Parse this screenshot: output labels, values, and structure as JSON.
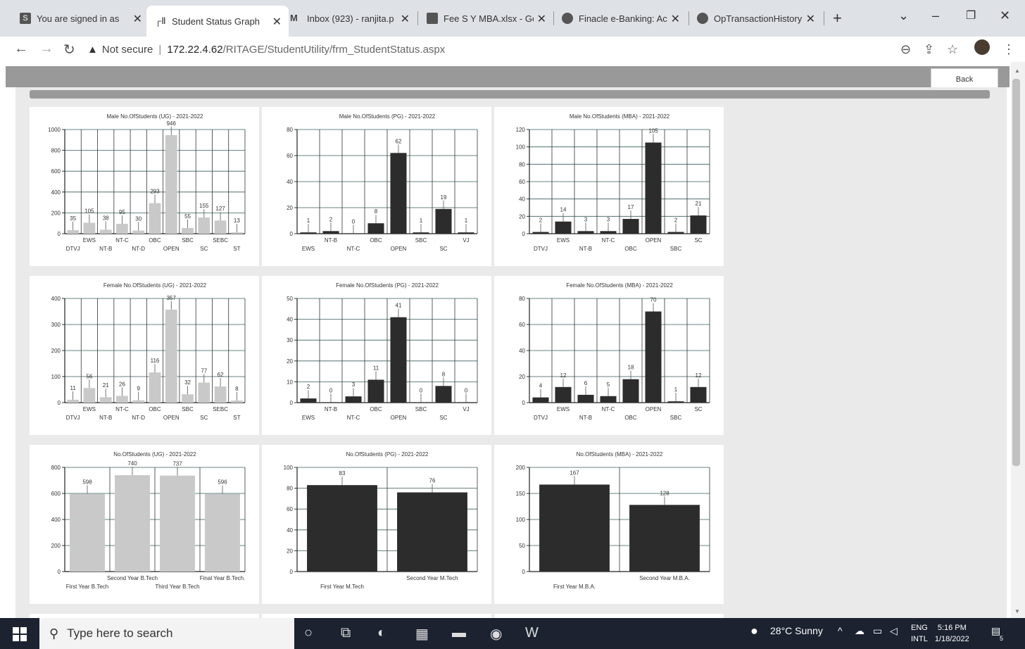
{
  "browser": {
    "tabs": [
      {
        "title": "You are signed in as E",
        "icon": "site-icon"
      },
      {
        "title": "Student Status Graph",
        "icon": "chart-icon"
      },
      {
        "title": "Inbox (923) - ranjita.p",
        "icon": "gmail-icon"
      },
      {
        "title": "Fee S Y MBA.xlsx - Go",
        "icon": "sheets-icon"
      },
      {
        "title": "Finacle e-Banking: Ac",
        "icon": "globe-icon"
      },
      {
        "title": "OpTransactionHistory",
        "icon": "globe-icon"
      }
    ],
    "address": {
      "security": "Not secure",
      "host": "172.22.4.62",
      "path": "/RITAGE/StudentUtility/frm_StudentStatus.aspx"
    }
  },
  "page": {
    "back_label": "Back"
  },
  "taskbar": {
    "search_placeholder": "Type here to search",
    "weather": "28°C  Sunny",
    "lang1": "ENG",
    "lang2": "INTL",
    "time": "5:16 PM",
    "date": "1/18/2022",
    "notif_count": "5"
  },
  "colors": {
    "light_bar": "#c9c9c9",
    "dark_bar": "#2c2c2c",
    "gridline": "#3a5a5a"
  },
  "chart_data": [
    {
      "type": "bar",
      "title": "Male  No.OfStudents (UG) - 2021-2022",
      "categories": [
        "DTVJ",
        "EWS",
        "NT-B",
        "NT-C",
        "NT-D",
        "OBC",
        "OPEN",
        "SBC",
        "SC",
        "SEBC",
        "ST"
      ],
      "values": [
        35,
        105,
        38,
        95,
        30,
        293,
        946,
        55,
        155,
        127,
        13
      ],
      "ylim": [
        0,
        1000
      ],
      "yticks": [
        0,
        200,
        400,
        600,
        800,
        1000
      ],
      "bar": "light"
    },
    {
      "type": "bar",
      "title": "Male  No.OfStudents (PG) - 2021-2022",
      "categories": [
        "EWS",
        "NT-B",
        "NT-C",
        "OBC",
        "OPEN",
        "SBC",
        "SC",
        "VJ"
      ],
      "values": [
        1,
        2,
        0,
        8,
        62,
        1,
        19,
        1
      ],
      "ylim": [
        0,
        80
      ],
      "yticks": [
        0,
        20,
        40,
        60,
        80
      ],
      "bar": "dark"
    },
    {
      "type": "bar",
      "title": "Male  No.OfStudents (MBA) - 2021-2022",
      "categories": [
        "DTVJ",
        "EWS",
        "NT-B",
        "NT-C",
        "OBC",
        "OPEN",
        "SBC",
        "SC"
      ],
      "values": [
        2,
        14,
        3,
        3,
        17,
        105,
        2,
        21
      ],
      "ylim": [
        0,
        120
      ],
      "yticks": [
        0,
        20,
        40,
        60,
        80,
        100,
        120
      ],
      "bar": "dark"
    },
    {
      "type": "bar",
      "title": "Female  No.OfStudents (UG) - 2021-2022",
      "categories": [
        "DTVJ",
        "EWS",
        "NT-B",
        "NT-C",
        "NT-D",
        "OBC",
        "OPEN",
        "SBC",
        "SC",
        "SEBC",
        "ST"
      ],
      "values": [
        11,
        56,
        21,
        26,
        9,
        116,
        357,
        32,
        77,
        62,
        8
      ],
      "ylim": [
        0,
        400
      ],
      "yticks": [
        0,
        100,
        200,
        300,
        400
      ],
      "bar": "light"
    },
    {
      "type": "bar",
      "title": "Female  No.OfStudents (PG) - 2021-2022",
      "categories": [
        "EWS",
        "NT-B",
        "NT-C",
        "OBC",
        "OPEN",
        "SBC",
        "SC",
        "VJ"
      ],
      "values": [
        2,
        0,
        3,
        11,
        41,
        0,
        8,
        0
      ],
      "ylim": [
        0,
        50
      ],
      "yticks": [
        0,
        10,
        20,
        30,
        40,
        50
      ],
      "bar": "dark"
    },
    {
      "type": "bar",
      "title": "Female  No.OfStudents (MBA) - 2021-2022",
      "categories": [
        "DTVJ",
        "EWS",
        "NT-B",
        "NT-C",
        "OBC",
        "OPEN",
        "SBC",
        "SC"
      ],
      "values": [
        4,
        12,
        6,
        5,
        18,
        70,
        1,
        12
      ],
      "ylim": [
        0,
        80
      ],
      "yticks": [
        0,
        20,
        40,
        60,
        80
      ],
      "bar": "dark"
    },
    {
      "type": "bar",
      "title": "No.OfStudents (UG) - 2021-2022",
      "categories": [
        "First Year B.Tech",
        "Second Year B.Tech",
        "Third Year B.Tech",
        "Final Year B.Tech."
      ],
      "values": [
        598,
        740,
        737,
        596
      ],
      "ylim": [
        0,
        800
      ],
      "yticks": [
        0,
        200,
        400,
        600,
        800
      ],
      "bar": "light"
    },
    {
      "type": "bar",
      "title": "No.OfStudents (PG) - 2021-2022",
      "categories": [
        "First Year M.Tech",
        "Second Year M.Tech"
      ],
      "values": [
        83,
        76
      ],
      "ylim": [
        0,
        100
      ],
      "yticks": [
        0,
        20,
        40,
        60,
        80,
        100
      ],
      "bar": "dark"
    },
    {
      "type": "bar",
      "title": "No.OfStudents (MBA) - 2021-2022",
      "categories": [
        "First Year M.B.A.",
        "Second Year M.B.A."
      ],
      "values": [
        167,
        128
      ],
      "ylim": [
        0,
        200
      ],
      "yticks": [
        0,
        50,
        100,
        150,
        200
      ],
      "bar": "dark"
    }
  ]
}
